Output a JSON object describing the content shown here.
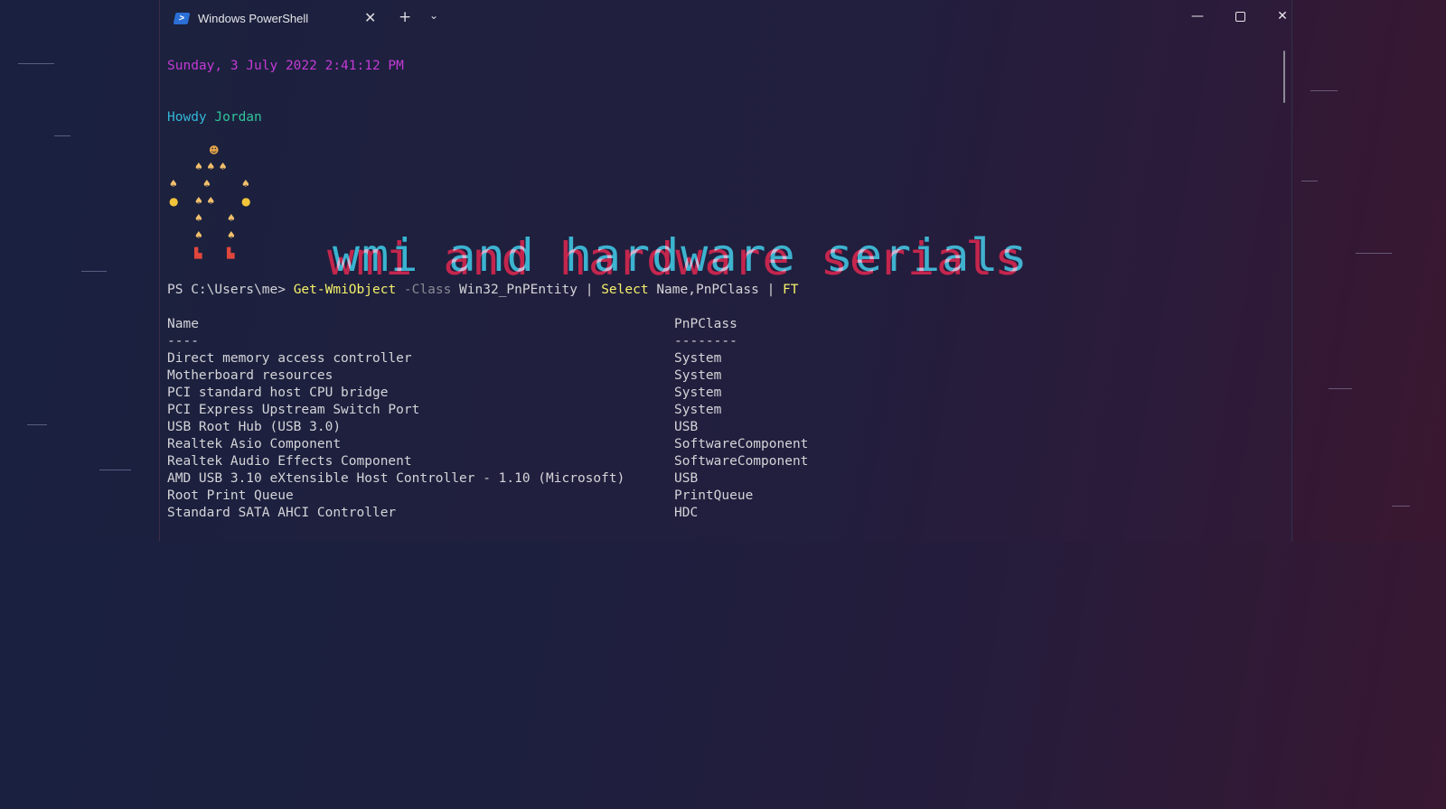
{
  "window": {
    "tab_title": "Windows PowerShell",
    "tab_icon": "powershell-icon",
    "new_tab": "+",
    "tab_close": "✕",
    "dropdown": "⌄",
    "minimize": "—",
    "close": "✕"
  },
  "terminal": {
    "date_line": "Sunday, 3 July 2022 2:41:12 PM",
    "greeting_word": "Howdy",
    "greeting_name": "Jordan",
    "prompt": "PS C:\\Users\\me> ",
    "command": {
      "cmdlet": "Get-WmiObject",
      "param": "-Class",
      "arg": "Win32_PnPEntity",
      "pipe1": "|",
      "select": "Select",
      "fields": "Name,PnPClass",
      "pipe2": "|",
      "ft": "FT"
    },
    "headers": [
      "Name",
      "PnPClass"
    ],
    "underlines": [
      "----",
      "--------"
    ],
    "rows": [
      {
        "name": "Direct memory access controller",
        "class": "System"
      },
      {
        "name": "Motherboard resources",
        "class": "System"
      },
      {
        "name": "PCI standard host CPU bridge",
        "class": "System"
      },
      {
        "name": "PCI Express Upstream Switch Port",
        "class": "System"
      },
      {
        "name": "USB Root Hub (USB 3.0)",
        "class": "USB"
      },
      {
        "name": "Realtek Asio Component",
        "class": "SoftwareComponent"
      },
      {
        "name": "Realtek Audio Effects Component",
        "class": "SoftwareComponent"
      },
      {
        "name": "AMD USB 3.10 eXtensible Host Controller - 1.10 (Microsoft)",
        "class": "USB"
      },
      {
        "name": "Root Print Queue",
        "class": "PrintQueue"
      },
      {
        "name": "Standard SATA AHCI Controller",
        "class": "HDC"
      }
    ]
  },
  "overlay_title": "wmi and hardware serials",
  "colors": {
    "date": "#c43bd6",
    "greeting": "#33b6d6",
    "command": "#f5f06a",
    "param": "#8a8a94",
    "text": "#d4d4d8"
  }
}
